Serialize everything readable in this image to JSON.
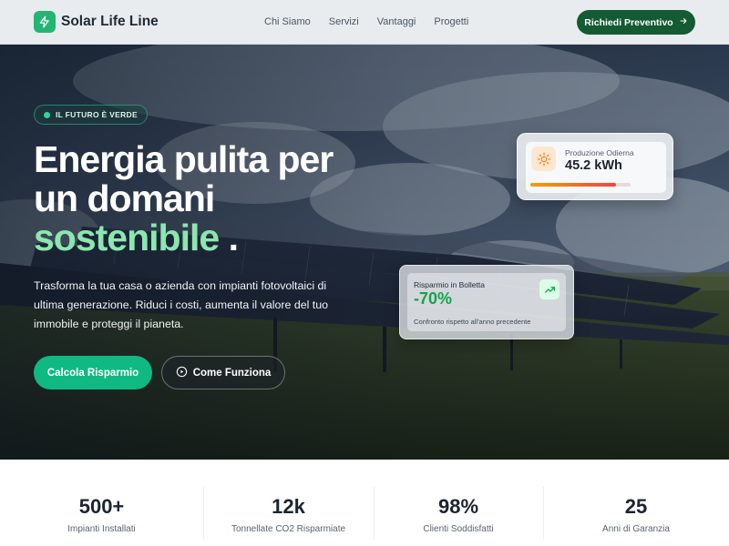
{
  "brand": {
    "name": "Solar Life Line",
    "accent": "#22b573",
    "dark_green": "#145a32"
  },
  "nav": {
    "links": [
      "Chi Siamo",
      "Servizi",
      "Vantaggi",
      "Progetti"
    ],
    "cta_label": "Richiedi Preventivo",
    "cta_icon": "arrow-right-icon"
  },
  "hero": {
    "badge": "IL FUTURO È VERDE",
    "title_line1": "Energia pulita per",
    "title_line2": "un domani",
    "title_highlight": "sostenibile",
    "title_end": ".",
    "subtitle": "Trasforma la tua casa o azienda con impianti fotovoltaici di ultima generazione. Riduci i costi, aumenta il valore del tuo immobile e proteggi il pianeta.",
    "primary_button": "Calcola Risparmio",
    "secondary_button": "Come Funziona",
    "secondary_icon": "play-circle-icon"
  },
  "cards": {
    "production": {
      "label": "Produzione Odierna",
      "value": "45.2 kWh",
      "icon": "sun-icon",
      "progress": 0.85
    },
    "savings": {
      "label": "Risparmio in Bolletta",
      "value": "-70%",
      "note": "Confronto rispetto all'anno precedente",
      "icon": "trending-up-icon"
    }
  },
  "stats": [
    {
      "value": "500+",
      "label": "Impianti Installati"
    },
    {
      "value": "12k",
      "label": "Tonnellate CO2 Risparmiate"
    },
    {
      "value": "98%",
      "label": "Clienti Soddisfatti"
    },
    {
      "value": "25",
      "label": "Anni di Garanzia"
    }
  ]
}
